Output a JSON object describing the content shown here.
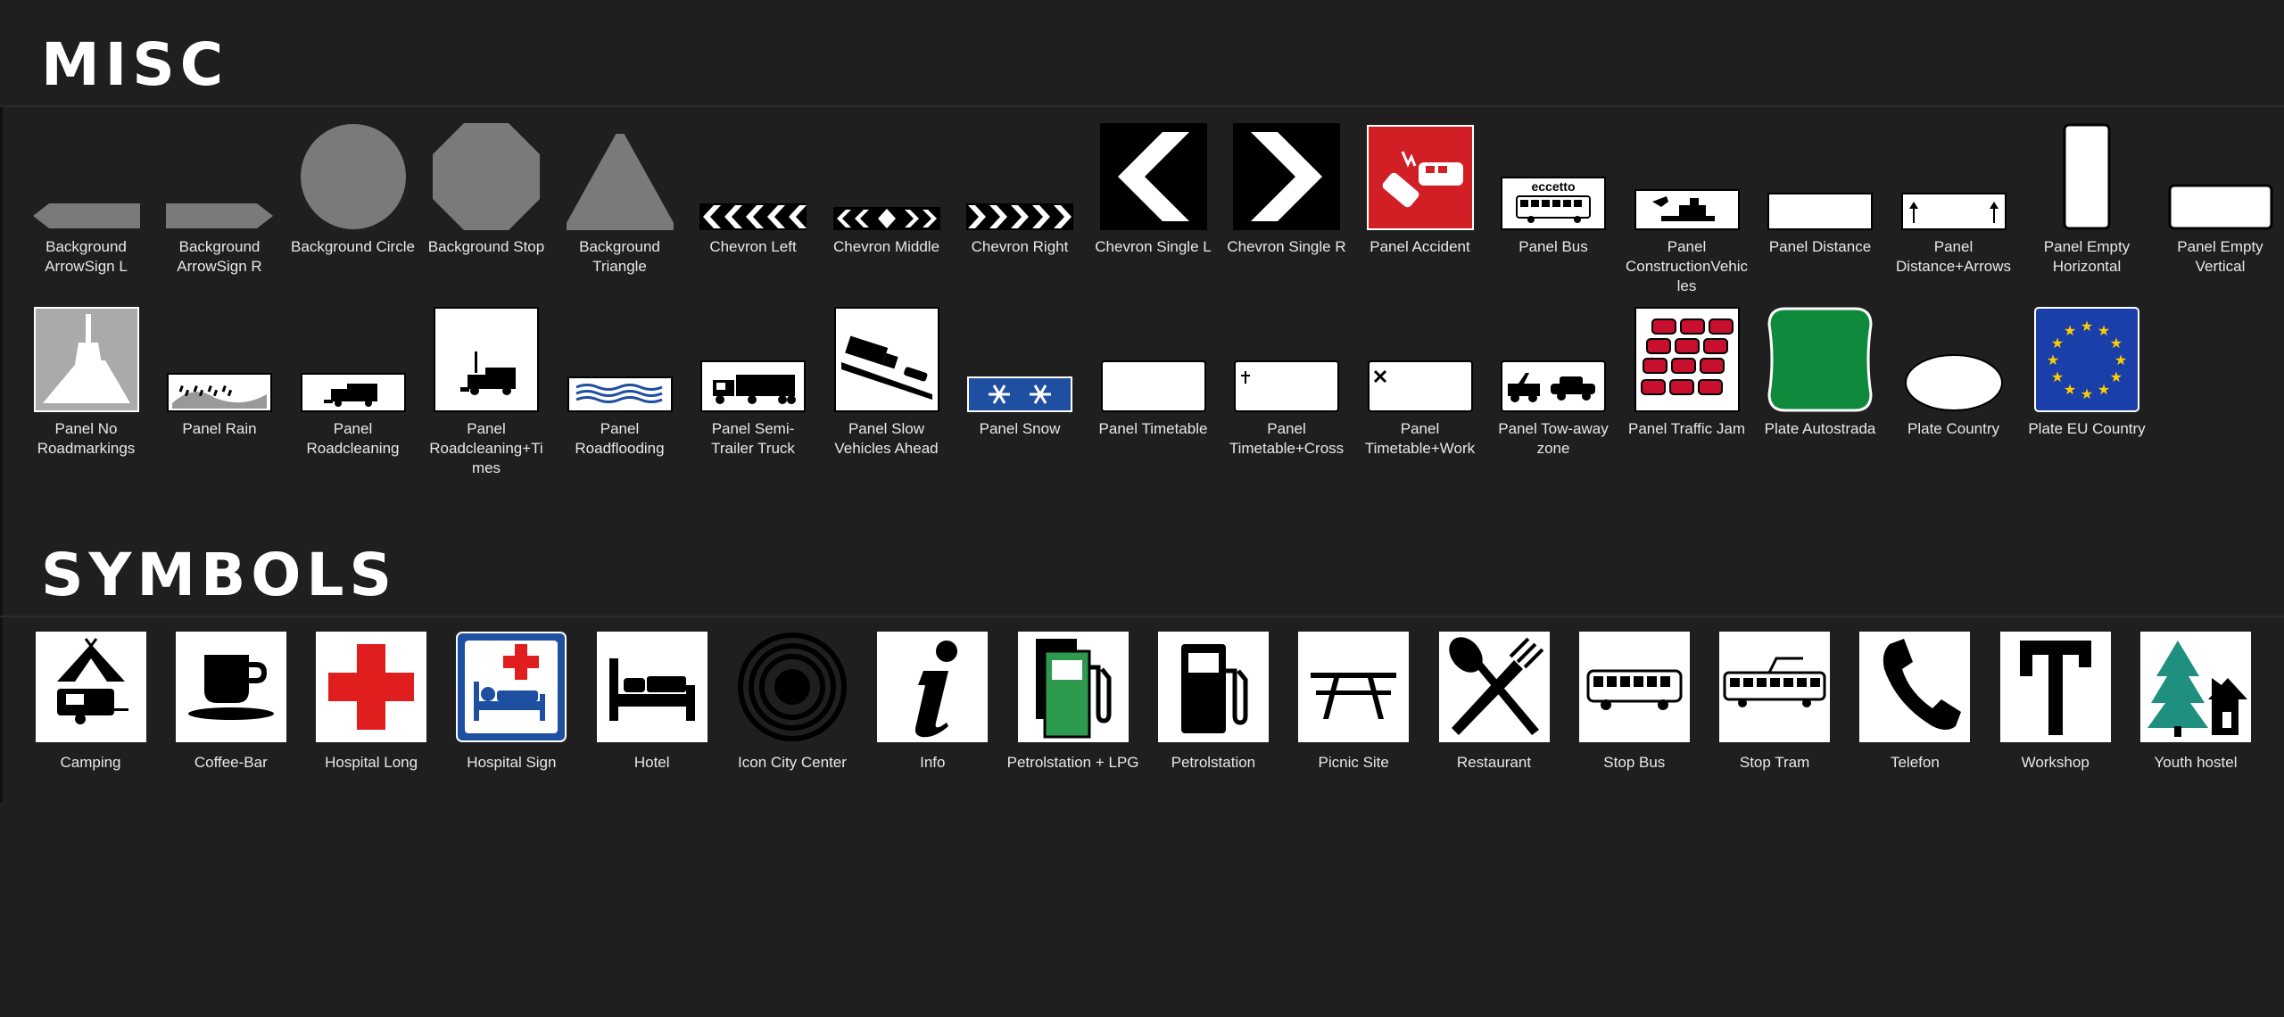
{
  "sections": {
    "misc": {
      "title": "MISC"
    },
    "symbols": {
      "title": "SYMBOLS"
    }
  },
  "misc_items": [
    {
      "label": "Background ArrowSign L",
      "icon": "arrow-sign-left-icon"
    },
    {
      "label": "Background ArrowSign R",
      "icon": "arrow-sign-right-icon"
    },
    {
      "label": "Background Circle",
      "icon": "circle-icon"
    },
    {
      "label": "Background Stop",
      "icon": "octagon-icon"
    },
    {
      "label": "Background Triangle",
      "icon": "triangle-icon"
    },
    {
      "label": "Chevron Left",
      "icon": "chevron-left-icon"
    },
    {
      "label": "Chevron Middle",
      "icon": "chevron-middle-icon"
    },
    {
      "label": "Chevron Right",
      "icon": "chevron-right-icon"
    },
    {
      "label": "Chevron Single L",
      "icon": "chevron-single-left-icon"
    },
    {
      "label": "Chevron Single R",
      "icon": "chevron-single-right-icon"
    },
    {
      "label": "Panel Accident",
      "icon": "accident-icon"
    },
    {
      "label": "Panel Bus",
      "icon": "bus-panel-icon",
      "text": "eccetto"
    },
    {
      "label": "Panel ConstructionVehicles",
      "icon": "construction-vehicle-icon"
    },
    {
      "label": "Panel Distance",
      "icon": "distance-panel-icon"
    },
    {
      "label": "Panel Distance+Arrows",
      "icon": "distance-arrows-icon"
    },
    {
      "label": "Panel Empty Horizontal",
      "icon": "empty-horizontal-icon"
    },
    {
      "label": "Panel Empty Vertical",
      "icon": "empty-vertical-icon"
    },
    {
      "label": "Panel No Roadmarkings",
      "icon": "no-roadmarkings-icon"
    },
    {
      "label": "Panel Rain",
      "icon": "rain-icon"
    },
    {
      "label": "Panel Roadcleaning",
      "icon": "roadcleaning-icon"
    },
    {
      "label": "Panel Roadcleaning+Times",
      "icon": "roadcleaning-times-icon"
    },
    {
      "label": "Panel Roadflooding",
      "icon": "roadflooding-icon"
    },
    {
      "label": "Panel Semi-Trailer Truck",
      "icon": "semi-trailer-truck-icon"
    },
    {
      "label": "Panel Slow Vehicles Ahead",
      "icon": "slow-vehicles-icon"
    },
    {
      "label": "Panel Snow",
      "icon": "snow-icon"
    },
    {
      "label": "Panel Timetable",
      "icon": "timetable-icon"
    },
    {
      "label": "Panel Timetable+Cross",
      "icon": "timetable-cross-icon"
    },
    {
      "label": "Panel Timetable+Work",
      "icon": "timetable-work-icon"
    },
    {
      "label": "Panel Tow-away zone",
      "icon": "tow-away-icon"
    },
    {
      "label": "Panel Traffic Jam",
      "icon": "traffic-jam-icon"
    },
    {
      "label": "Plate Autostrada",
      "icon": "autostrada-plate-icon"
    },
    {
      "label": "Plate Country",
      "icon": "country-plate-icon"
    },
    {
      "label": "Plate EU Country",
      "icon": "eu-flag-icon"
    }
  ],
  "symbol_items": [
    {
      "label": "Camping",
      "icon": "camping-icon"
    },
    {
      "label": "Coffee-Bar",
      "icon": "coffee-cup-icon"
    },
    {
      "label": "Hospital Long",
      "icon": "red-cross-icon"
    },
    {
      "label": "Hospital Sign",
      "icon": "hospital-bed-icon"
    },
    {
      "label": "Hotel",
      "icon": "bed-icon"
    },
    {
      "label": "Icon City Center",
      "icon": "city-center-icon"
    },
    {
      "label": "Info",
      "icon": "info-icon"
    },
    {
      "label": "Petrolstation + LPG",
      "icon": "fuel-lpg-icon"
    },
    {
      "label": "Petrolstation",
      "icon": "fuel-pump-icon"
    },
    {
      "label": "Picnic Site",
      "icon": "picnic-table-icon"
    },
    {
      "label": "Restaurant",
      "icon": "fork-spoon-icon"
    },
    {
      "label": "Stop Bus",
      "icon": "bus-icon"
    },
    {
      "label": "Stop Tram",
      "icon": "tram-icon"
    },
    {
      "label": "Telefon",
      "icon": "telephone-icon"
    },
    {
      "label": "Workshop",
      "icon": "wrench-icon"
    },
    {
      "label": "Youth hostel",
      "icon": "youth-hostel-icon"
    }
  ],
  "colors": {
    "background": "#1f1f1f",
    "sign_gray": "#7a7a7a",
    "accident_red": "#d21f26",
    "snow_blue": "#1f4fa0",
    "autostrada_green": "#0f8a3c",
    "eu_blue": "#1b3fa8",
    "eu_star": "#ffcc00",
    "cross_red": "#e01e1e",
    "lpg_green": "#2e9a4e",
    "tree_teal": "#1f8f80"
  }
}
